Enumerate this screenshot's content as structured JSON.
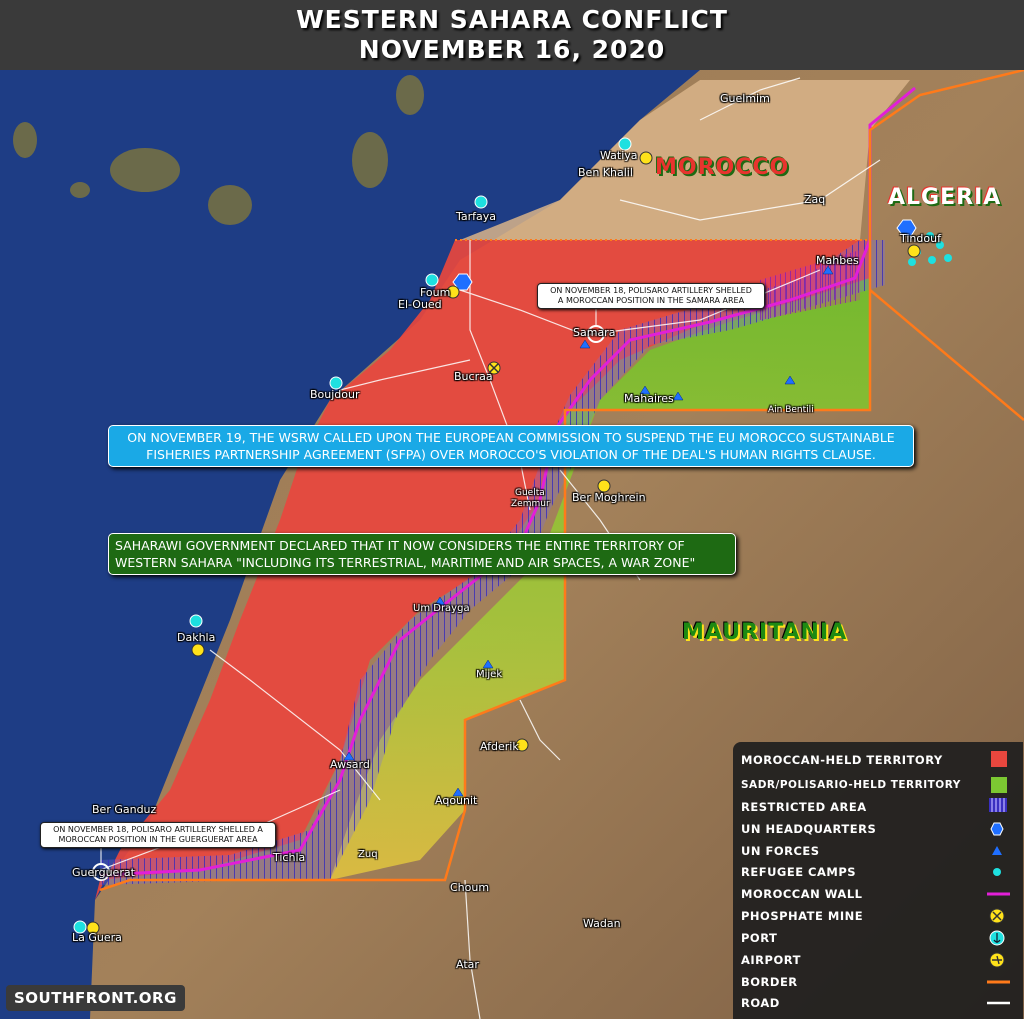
{
  "header": {
    "title": "WESTERN SAHARA CONFLICT",
    "date": "NOVEMBER 16, 2020"
  },
  "countries": {
    "morocco": "MOROCCO",
    "algeria": "ALGERIA",
    "mauritania": "MAURITANIA"
  },
  "places": {
    "guelmim": "Guelmim",
    "watiya": "Watiya",
    "ben_khalil": "Ben Khalil",
    "tarfaya": "Tarfaya",
    "zaq": "Zaq",
    "tindouf": "Tindouf",
    "mahbes": "Mahbes",
    "foum_el_oued_1": "Foum",
    "foum_el_oued_2": "El-Oued",
    "samara": "Samara",
    "bucraa": "Bucraa",
    "boujdour": "Boujdour",
    "mahaires": "Mahaires",
    "ain_bentili": "Ain Bentili",
    "guelta_1": "Guelta",
    "guelta_2": "Zemmur",
    "ber_moghrein": "Ber Moghrein",
    "um_drayga": "Um Drayga",
    "dakhla": "Dakhla",
    "mijek": "Mijek",
    "awsard": "Awsard",
    "afderik": "Afderik",
    "ber_ganduz": "Ber Ganduz",
    "aqounit": "Aqounit",
    "tichla": "Tichla",
    "zuq": "Zuq",
    "guerguerat": "Guerguerat",
    "choum": "Choum",
    "la_guera": "La Guera",
    "wadan": "Wadan",
    "atar": "Atar"
  },
  "callouts": {
    "samara_line1": "ON NOVEMBER 18, POLISARO ARTILLERY SHELLED",
    "samara_line2": "A MOROCCAN POSITION IN THE SAMARA AREA",
    "guerguerat_line1": "ON NOVEMBER 18, POLISARO ARTILLERY SHELLED A",
    "guerguerat_line2": "MOROCCAN POSITION IN THE GUERGUERAT AREA"
  },
  "banners": {
    "blue_line1": "ON NOVEMBER 19, THE WSRW CALLED UPON THE EUROPEAN COMMISSION TO SUSPEND THE EU MOROCCO SUSTAINABLE",
    "blue_line2": "FISHERIES PARTNERSHIP AGREEMENT (SFPA) OVER MOROCCO'S VIOLATION OF THE DEAL'S HUMAN RIGHTS CLAUSE.",
    "green_line1": "SAHARAWI GOVERNMENT DECLARED THAT IT NOW CONSIDERS THE ENTIRE TERRITORY OF",
    "green_line2": "WESTERN SAHARA \"INCLUDING ITS TERRESTRIAL, MARITIME AND AIR SPACES, A WAR ZONE\""
  },
  "legend": {
    "moroccan_held": "MOROCCAN-HELD TERRITORY",
    "sadr_held": "SADR/POLISARIO-HELD TERRITORY",
    "restricted": "RESTRICTED AREA",
    "un_hq": "UN HEADQUARTERS",
    "un_forces": "UN FORCES",
    "refugee": "REFUGEE CAMPS",
    "wall": "MOROCCAN WALL",
    "phosphate": "PHOSPHATE MINE",
    "port": "PORT",
    "airport": "AIRPORT",
    "border": "BORDER",
    "road": "ROAD"
  },
  "colors": {
    "moroccan": "#e8473e",
    "sadr": "#7cc832",
    "restricted": "#4a3fd0",
    "wall": "#e21fd8",
    "border": "#ff7a1a",
    "un": "#1f6fff",
    "refugee": "#1ee0e0",
    "yellow": "#ffe21a",
    "ocean": "#1e3d85"
  },
  "footer": {
    "logo": "SOUTHFRONT.ORG"
  }
}
